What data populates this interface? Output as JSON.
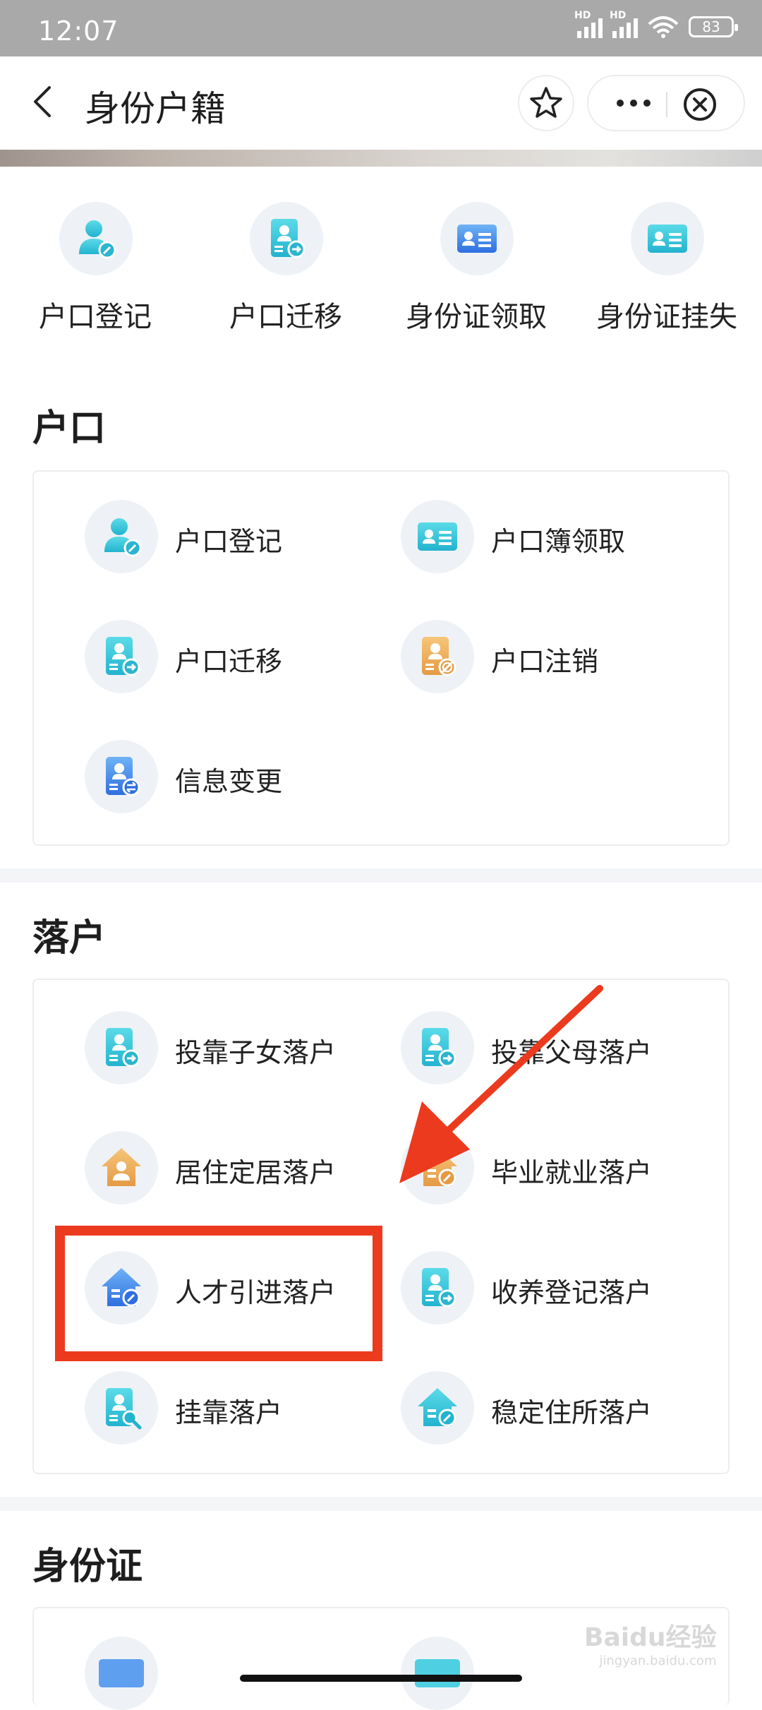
{
  "status": {
    "time": "12:07",
    "battery": "83",
    "hd1": "HD",
    "hd2": "HD"
  },
  "header": {
    "title": "身份户籍"
  },
  "quick_actions": [
    {
      "label": "户口登记",
      "icon": "person-edit-icon"
    },
    {
      "label": "户口迁移",
      "icon": "doc-transfer-icon"
    },
    {
      "label": "身份证领取",
      "icon": "id-card-icon"
    },
    {
      "label": "身份证挂失",
      "icon": "id-card-icon"
    }
  ],
  "sections": {
    "hukou": {
      "title": "户口",
      "items": [
        {
          "label": "户口登记",
          "icon": "person-edit-icon"
        },
        {
          "label": "户口簿领取",
          "icon": "id-card-icon"
        },
        {
          "label": "户口迁移",
          "icon": "doc-transfer-icon"
        },
        {
          "label": "户口注销",
          "icon": "doc-cancel-icon"
        },
        {
          "label": "信息变更",
          "icon": "doc-exchange-icon"
        }
      ]
    },
    "settle": {
      "title": "落户",
      "items": [
        {
          "label": "投靠子女落户",
          "icon": "doc-transfer-icon"
        },
        {
          "label": "投靠父母落户",
          "icon": "doc-transfer-icon"
        },
        {
          "label": "居住定居落户",
          "icon": "house-person-icon"
        },
        {
          "label": "毕业就业落户",
          "icon": "house-edit-icon"
        },
        {
          "label": "人才引进落户",
          "icon": "house-edit-icon"
        },
        {
          "label": "收养登记落户",
          "icon": "doc-transfer-icon"
        },
        {
          "label": "挂靠落户",
          "icon": "doc-search-icon"
        },
        {
          "label": "稳定住所落户",
          "icon": "house-edit-icon"
        }
      ]
    },
    "idcard": {
      "title": "身份证"
    }
  },
  "watermark": {
    "brand": "Baidu经验",
    "url": "jingyan.baidu.com"
  },
  "colors": {
    "accent_red": "#ec3a1e",
    "icon_cyan": "#31c3d6",
    "icon_blue": "#3d82e8",
    "icon_orange": "#e9a550"
  }
}
